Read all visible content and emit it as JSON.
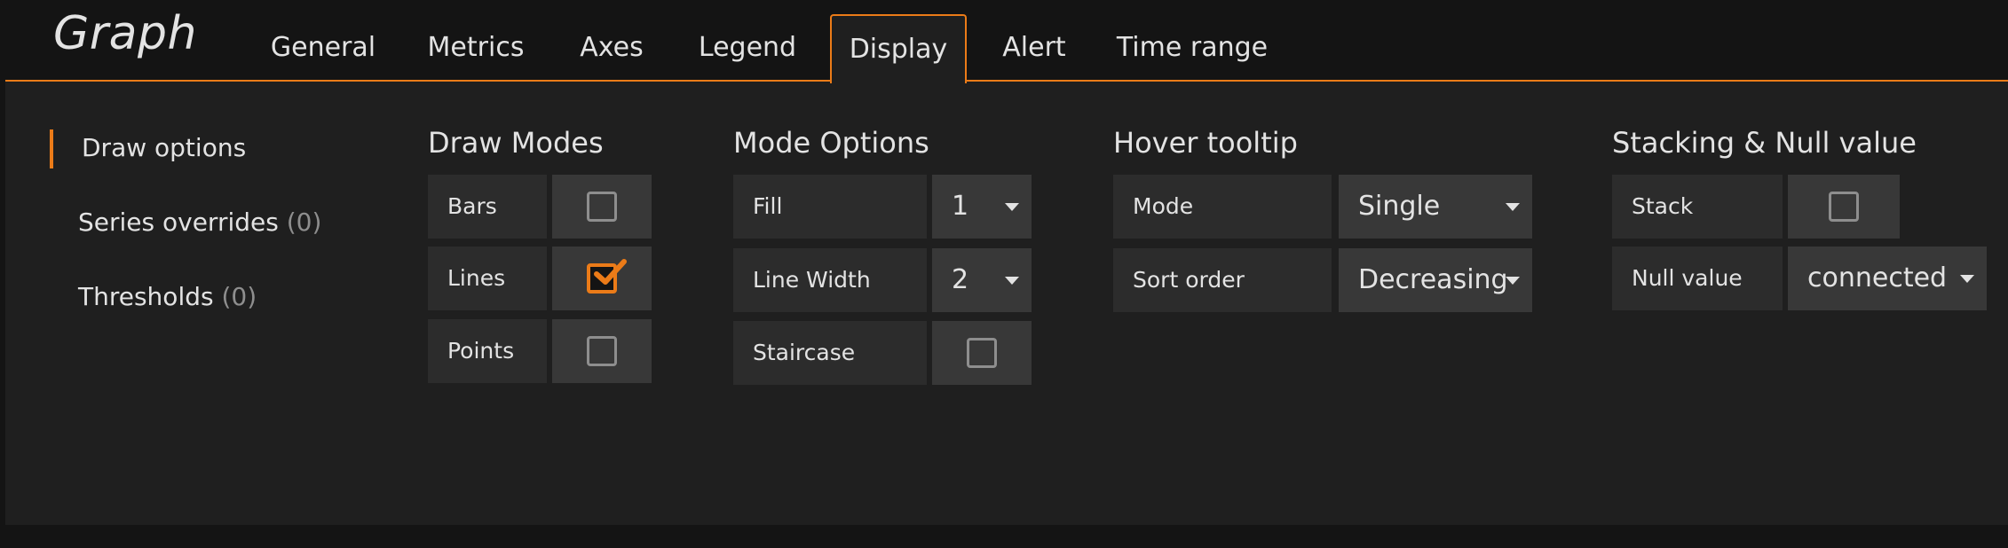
{
  "panel": {
    "title": "Graph"
  },
  "tabs": [
    {
      "label": "General"
    },
    {
      "label": "Metrics"
    },
    {
      "label": "Axes"
    },
    {
      "label": "Legend"
    },
    {
      "label": "Display"
    },
    {
      "label": "Alert"
    },
    {
      "label": "Time range"
    }
  ],
  "sidebar": {
    "items": [
      {
        "label": "Draw options",
        "count": ""
      },
      {
        "label": "Series overrides",
        "count": "(0)"
      },
      {
        "label": "Thresholds",
        "count": "(0)"
      }
    ]
  },
  "draw_modes": {
    "title": "Draw Modes",
    "bars": {
      "label": "Bars",
      "checked": false
    },
    "lines": {
      "label": "Lines",
      "checked": true
    },
    "points": {
      "label": "Points",
      "checked": false
    }
  },
  "mode_options": {
    "title": "Mode Options",
    "fill": {
      "label": "Fill",
      "value": "1"
    },
    "line_width": {
      "label": "Line Width",
      "value": "2"
    },
    "staircase": {
      "label": "Staircase",
      "checked": false
    }
  },
  "hover_tooltip": {
    "title": "Hover tooltip",
    "mode": {
      "label": "Mode",
      "value": "Single"
    },
    "sort_order": {
      "label": "Sort order",
      "value": "Decreasing"
    }
  },
  "stacking": {
    "title": "Stacking & Null value",
    "stack": {
      "label": "Stack",
      "checked": false
    },
    "null_value": {
      "label": "Null value",
      "value": "connected"
    }
  },
  "colors": {
    "accent": "#eb7b18",
    "background": "#141414",
    "panel": "#1f1f1f",
    "label_bg": "#2c2c2c",
    "control_bg": "#383838"
  }
}
